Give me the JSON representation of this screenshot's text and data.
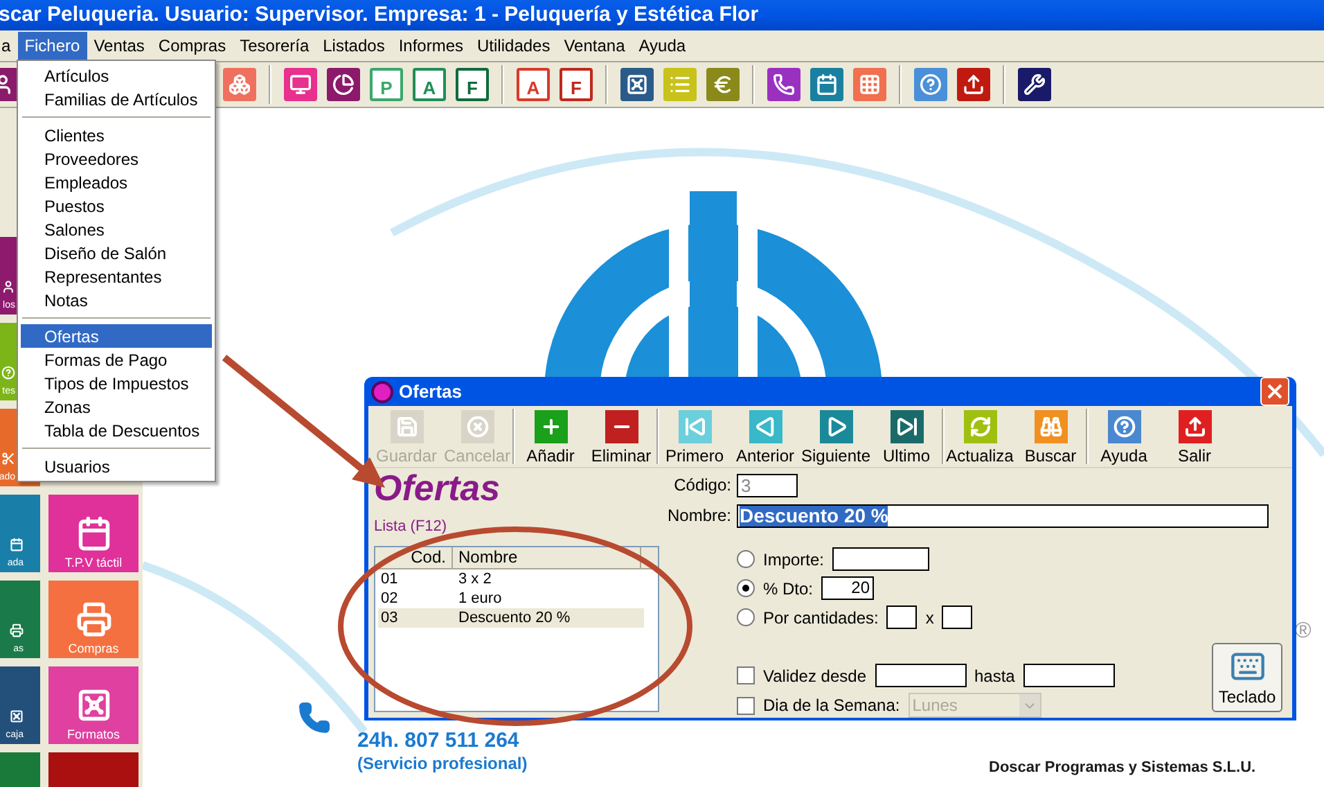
{
  "window": {
    "title": "scar Peluqueria. Usuario: Supervisor. Empresa: 1 - Peluquería y Estética Flor"
  },
  "menu_bar": [
    {
      "label": "a",
      "selected": false
    },
    {
      "label": "Fichero",
      "selected": true
    },
    {
      "label": "Ventas",
      "selected": false
    },
    {
      "label": "Compras",
      "selected": false
    },
    {
      "label": "Tesorería",
      "selected": false
    },
    {
      "label": "Listados",
      "selected": false
    },
    {
      "label": "Informes",
      "selected": false
    },
    {
      "label": "Utilidades",
      "selected": false
    },
    {
      "label": "Ventana",
      "selected": false
    },
    {
      "label": "Ayuda",
      "selected": false
    }
  ],
  "toolbar": [
    {
      "kind": "person",
      "color": "#8b1a6b"
    },
    {
      "kind": "boxes",
      "color": "#f07060"
    },
    {
      "kind": "separator"
    },
    {
      "kind": "screen",
      "color": "#e8308f"
    },
    {
      "kind": "pie",
      "color": "#8b1a6b"
    },
    {
      "kind": "letter",
      "label": "P",
      "color": "#3aa86b"
    },
    {
      "kind": "letter",
      "label": "A",
      "color": "#1e8f57"
    },
    {
      "kind": "letter",
      "label": "F",
      "color": "#0e6b3d"
    },
    {
      "kind": "separator"
    },
    {
      "kind": "letter",
      "label": "A",
      "color": "#d93a2a"
    },
    {
      "kind": "letter",
      "label": "F",
      "color": "#c0281c"
    },
    {
      "kind": "separator"
    },
    {
      "kind": "safe",
      "color": "#2a5b8a"
    },
    {
      "kind": "list",
      "color": "#c8c21a"
    },
    {
      "kind": "euro",
      "color": "#8a8a1a"
    },
    {
      "kind": "separator"
    },
    {
      "kind": "phone",
      "color": "#9a30c0"
    },
    {
      "kind": "calendar",
      "color": "#1a80a0"
    },
    {
      "kind": "grid",
      "color": "#f07050"
    },
    {
      "kind": "separator"
    },
    {
      "kind": "help",
      "color": "#4a90d8"
    },
    {
      "kind": "upload",
      "color": "#c01a10"
    },
    {
      "kind": "separator"
    },
    {
      "kind": "tools",
      "color": "#1a1a6a"
    }
  ],
  "open_menu": [
    {
      "kind": "item",
      "label": "Artículos",
      "selected": false
    },
    {
      "kind": "item",
      "label": "Familias de Artículos",
      "selected": false
    },
    {
      "kind": "separator"
    },
    {
      "kind": "item",
      "label": "Clientes",
      "selected": false
    },
    {
      "kind": "item",
      "label": "Proveedores",
      "selected": false
    },
    {
      "kind": "item",
      "label": "Empleados",
      "selected": false
    },
    {
      "kind": "item",
      "label": "Puestos",
      "selected": false
    },
    {
      "kind": "item",
      "label": "Salones",
      "selected": false
    },
    {
      "kind": "item",
      "label": "Diseño de Salón",
      "selected": false
    },
    {
      "kind": "item",
      "label": "Representantes",
      "selected": false
    },
    {
      "kind": "item",
      "label": "Notas",
      "selected": false
    },
    {
      "kind": "separator"
    },
    {
      "kind": "item",
      "label": "Ofertas",
      "selected": true
    },
    {
      "kind": "item",
      "label": "Formas de Pago",
      "selected": false
    },
    {
      "kind": "item",
      "label": "Tipos de Impuestos",
      "selected": false
    },
    {
      "kind": "item",
      "label": "Zonas",
      "selected": false
    },
    {
      "kind": "item",
      "label": "Tabla de Descuentos",
      "selected": false
    },
    {
      "kind": "separator"
    },
    {
      "kind": "item",
      "label": "Usuarios",
      "selected": false
    }
  ],
  "tiles_left": [
    {
      "label": "los",
      "color": "#8e1a6e"
    },
    {
      "label": "tes",
      "color": "#7cb518"
    },
    {
      "label": "ado",
      "color": "#e86a2a"
    },
    {
      "label": "ada",
      "color": "#1a7fa8"
    },
    {
      "label": "as",
      "color": "#1a7a4a"
    },
    {
      "label": "caja",
      "color": "#22507a"
    },
    {
      "color": "#1a7a3a"
    }
  ],
  "tiles_right": [
    {
      "label": "T.P.V táctil",
      "color": "#e0309a"
    },
    {
      "label": "Compras",
      "color": "#f57040"
    },
    {
      "label": "Formatos",
      "color": "#e040a0"
    },
    {
      "color": "#aa1010"
    }
  ],
  "contact": {
    "phone": "24h. 807 511 264",
    "note": "(Servicio profesional)"
  },
  "company": "Doscar Programas y Sistemas S.L.U.",
  "registered": "®",
  "dialog": {
    "title": "Ofertas",
    "toolbar": [
      {
        "kind": "save",
        "label": "Guardar",
        "disabled": true
      },
      {
        "kind": "cancel",
        "label": "Cancelar",
        "disabled": true
      },
      {
        "kind": "separator"
      },
      {
        "kind": "add",
        "label": "Añadir",
        "disabled": false
      },
      {
        "kind": "delete",
        "label": "Eliminar",
        "disabled": false
      },
      {
        "kind": "separator"
      },
      {
        "kind": "first",
        "label": "Primero",
        "disabled": false
      },
      {
        "kind": "prev",
        "label": "Anterior",
        "disabled": false
      },
      {
        "kind": "next",
        "label": "Siguiente",
        "disabled": false
      },
      {
        "kind": "last",
        "label": "Ultimo",
        "disabled": false
      },
      {
        "kind": "separator"
      },
      {
        "kind": "refresh",
        "label": "Actualiza",
        "disabled": false
      },
      {
        "kind": "search",
        "label": "Buscar",
        "disabled": false
      },
      {
        "kind": "separator"
      },
      {
        "kind": "help",
        "label": "Ayuda",
        "disabled": false
      },
      {
        "kind": "exit",
        "label": "Salir",
        "disabled": false
      }
    ],
    "heading": "Ofertas",
    "list_link": "Lista (F12)",
    "list": {
      "columns": [
        "Cod.",
        "Nombre"
      ],
      "rows": [
        {
          "cod": "01",
          "nombre": "3 x 2",
          "selected": false
        },
        {
          "cod": "02",
          "nombre": "1 euro",
          "selected": false
        },
        {
          "cod": "03",
          "nombre": "Descuento 20 %",
          "selected": true
        }
      ]
    },
    "codigo": {
      "label": "Código:",
      "value": "3",
      "disabled": true
    },
    "nombre": {
      "label": "Nombre:",
      "value": "Descuento 20 %"
    },
    "discount_options": [
      {
        "kind": "single",
        "label": "Importe:",
        "selected": false
      },
      {
        "kind": "single",
        "label": "% Dto:",
        "selected": true,
        "value": "20"
      },
      {
        "kind": "pair",
        "label": "Por cantidades:",
        "selected": false,
        "separator": "x"
      }
    ],
    "validity": {
      "label": "Validez desde",
      "checked": false,
      "to_label": "hasta"
    },
    "weekday": {
      "label": "Dia de la Semana:",
      "checked": false,
      "value": "Lunes"
    },
    "keyboard_button": "Teclado"
  }
}
